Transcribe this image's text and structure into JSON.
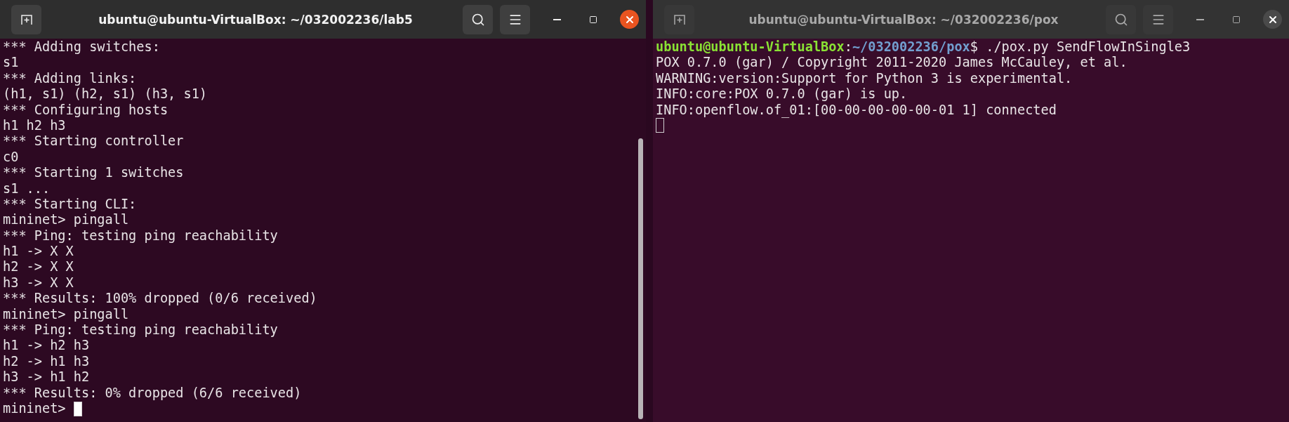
{
  "windows": [
    {
      "title": "ubuntu@ubuntu-VirtualBox: ~/032002236/lab5",
      "focused": true,
      "lines": [
        {
          "kind": "text",
          "text": "*** Adding switches:"
        },
        {
          "kind": "text",
          "text": "s1"
        },
        {
          "kind": "text",
          "text": "*** Adding links:"
        },
        {
          "kind": "text",
          "text": "(h1, s1) (h2, s1) (h3, s1)"
        },
        {
          "kind": "text",
          "text": "*** Configuring hosts"
        },
        {
          "kind": "text",
          "text": "h1 h2 h3"
        },
        {
          "kind": "text",
          "text": "*** Starting controller"
        },
        {
          "kind": "text",
          "text": "c0"
        },
        {
          "kind": "text",
          "text": "*** Starting 1 switches"
        },
        {
          "kind": "text",
          "text": "s1 ..."
        },
        {
          "kind": "text",
          "text": "*** Starting CLI:"
        },
        {
          "kind": "text",
          "text": "mininet> pingall"
        },
        {
          "kind": "text",
          "text": "*** Ping: testing ping reachability"
        },
        {
          "kind": "text",
          "text": "h1 -> X X"
        },
        {
          "kind": "text",
          "text": "h2 -> X X"
        },
        {
          "kind": "text",
          "text": "h3 -> X X"
        },
        {
          "kind": "text",
          "text": "*** Results: 100% dropped (0/6 received)"
        },
        {
          "kind": "text",
          "text": "mininet> pingall"
        },
        {
          "kind": "text",
          "text": "*** Ping: testing ping reachability"
        },
        {
          "kind": "text",
          "text": "h1 -> h2 h3"
        },
        {
          "kind": "text",
          "text": "h2 -> h1 h3"
        },
        {
          "kind": "text",
          "text": "h3 -> h1 h2"
        },
        {
          "kind": "text",
          "text": "*** Results: 0% dropped (6/6 received)"
        },
        {
          "kind": "input",
          "text": "mininet>"
        }
      ]
    },
    {
      "title": "ubuntu@ubuntu-VirtualBox: ~/032002236/pox",
      "focused": false,
      "lines": [
        {
          "kind": "prompt",
          "user": "ubuntu@ubuntu-VirtualBox",
          "sep": ":",
          "path": "~/032002236/pox",
          "command": "$ ./pox.py SendFlowInSingle3"
        },
        {
          "kind": "text",
          "text": "POX 0.7.0 (gar) / Copyright 2011-2020 James McCauley, et al."
        },
        {
          "kind": "text",
          "text": "WARNING:version:Support for Python 3 is experimental."
        },
        {
          "kind": "text",
          "text": "INFO:core:POX 0.7.0 (gar) is up."
        },
        {
          "kind": "text",
          "text": "INFO:openflow.of_01:[00-00-00-00-00-01 1] connected"
        },
        {
          "kind": "input"
        }
      ]
    }
  ]
}
